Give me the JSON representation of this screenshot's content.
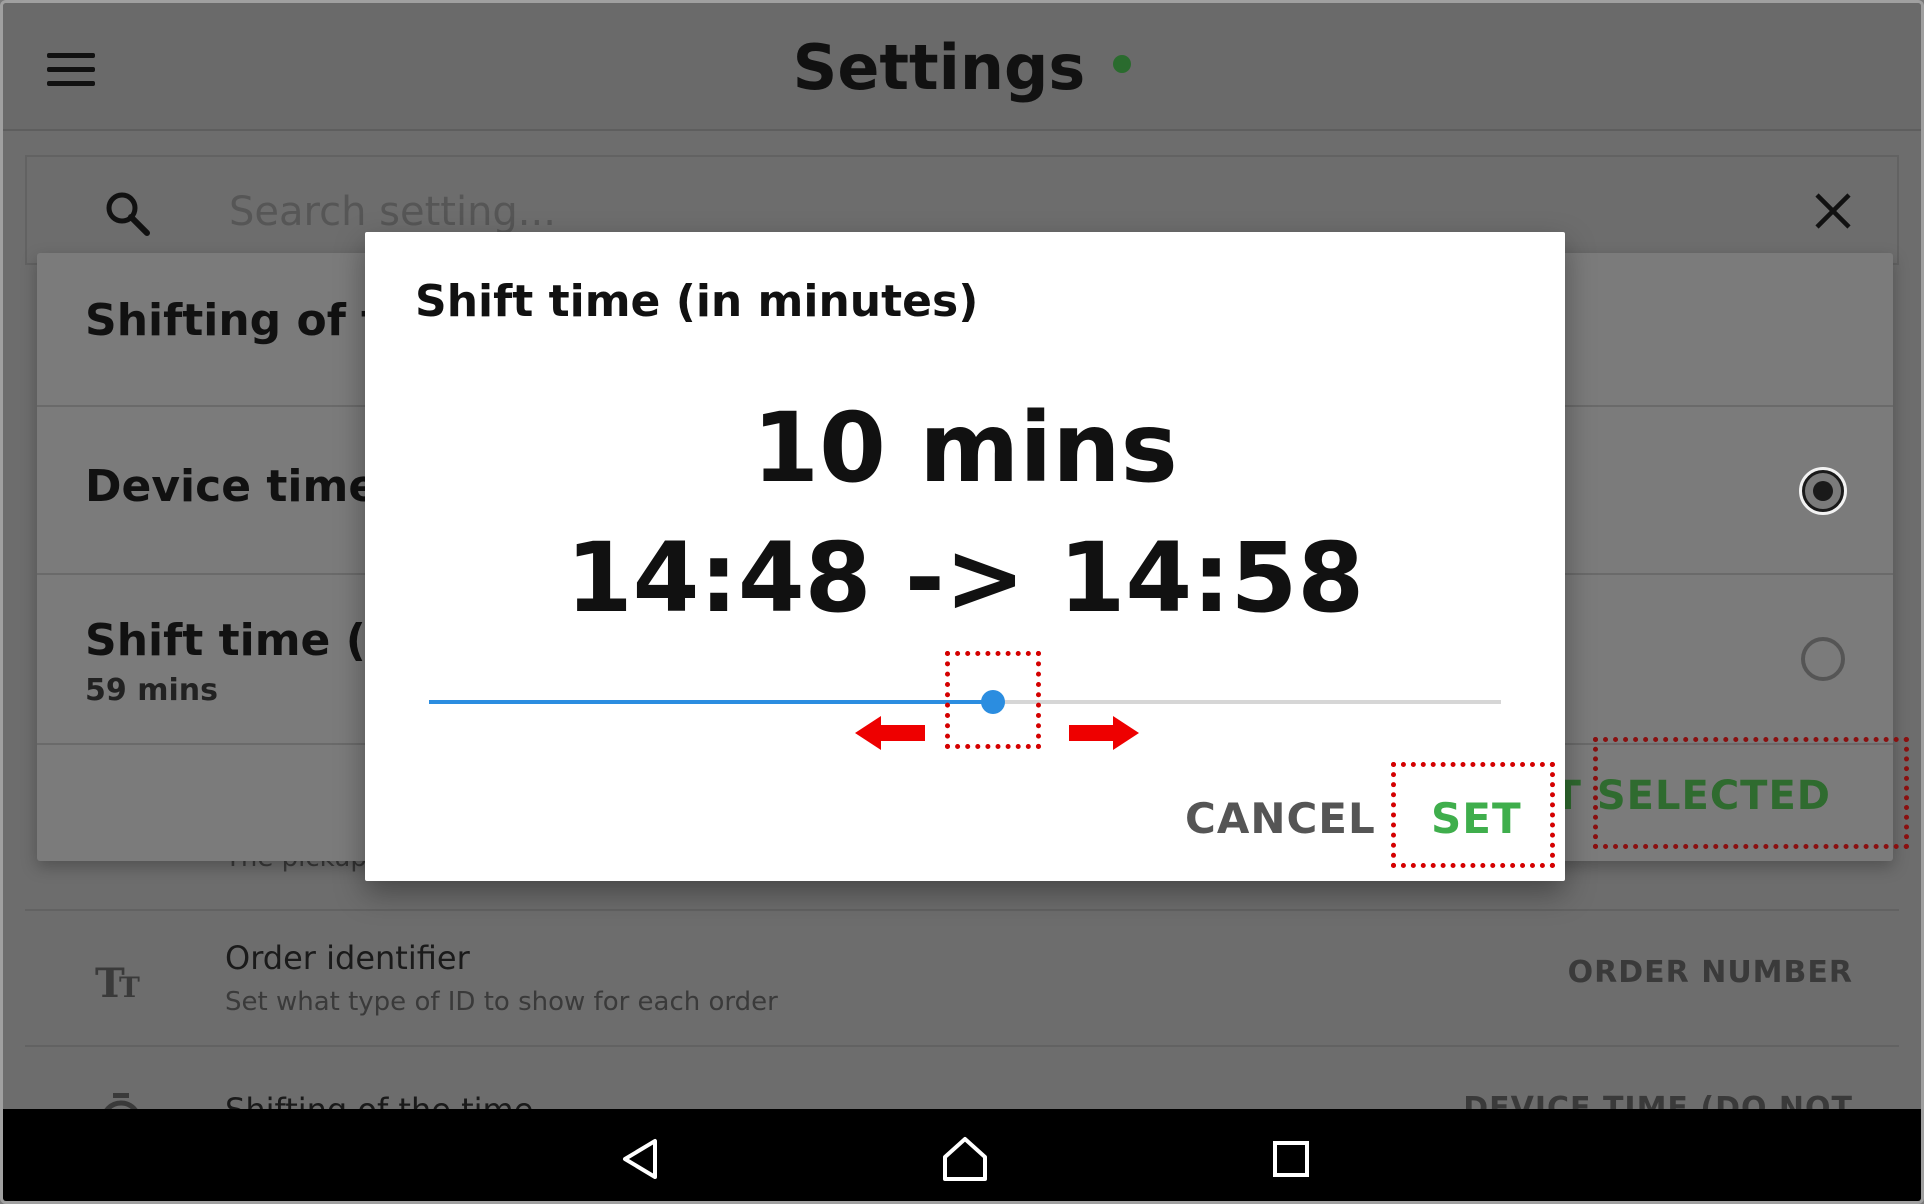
{
  "app": {
    "title": "Settings",
    "status_color": "#2a6b2e"
  },
  "search": {
    "placeholder": "Search setting..."
  },
  "list": {
    "items": [
      {
        "icon": "pickup-icon",
        "subtitle": "The pickup"
      },
      {
        "icon": "text-format-icon",
        "title": "Order identifier",
        "subtitle": "Set what type of ID to show for each order",
        "value": "ORDER NUMBER"
      },
      {
        "icon": "timer-icon",
        "title": "Shifting of the time",
        "value": "DEVICE TIME (DO NOT"
      }
    ]
  },
  "background_dialog": {
    "title": "Shifting of the",
    "options": [
      {
        "label": "Device time (",
        "selected": true
      },
      {
        "label": "Shift time (in",
        "sub": "59 mins",
        "selected": false
      }
    ],
    "confirm_label": "SET SELECTED"
  },
  "dialog": {
    "title": "Shift time (in minutes)",
    "value_text": "10 mins",
    "range_text": "14:48 -> 14:58",
    "slider_fraction": 0.526,
    "cancel_label": "CANCEL",
    "set_label": "SET",
    "accent_color": "#2b8de0",
    "set_color": "#3fae4c",
    "highlight_color": "#d40000"
  },
  "navbar": {
    "icons": [
      "back-icon",
      "home-icon",
      "recents-icon"
    ]
  }
}
